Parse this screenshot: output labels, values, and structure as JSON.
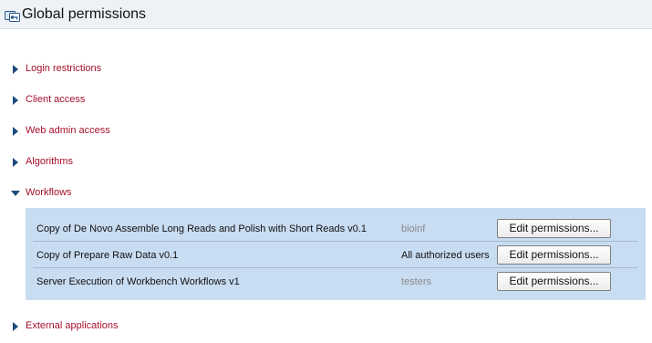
{
  "header": {
    "title": "Global permissions",
    "icon": "permissions-icon"
  },
  "colors": {
    "section_label": "#a4102a",
    "triangle": "#1f4a7c",
    "panel_bg": "#c8dcf2",
    "header_bg": "#eef2f6"
  },
  "sections": [
    {
      "label": "Login restrictions",
      "expanded": false
    },
    {
      "label": "Client access",
      "expanded": false
    },
    {
      "label": "Web admin access",
      "expanded": false
    },
    {
      "label": "Algorithms",
      "expanded": false
    },
    {
      "label": "Workflows",
      "expanded": true
    },
    {
      "label": "External applications",
      "expanded": false
    }
  ],
  "workflows": [
    {
      "name": "Copy of De Novo Assemble Long Reads and Polish with Short Reads v0.1",
      "group": "bioinf",
      "group_muted": true,
      "button": "Edit permissions..."
    },
    {
      "name": "Copy of Prepare Raw Data v0.1",
      "group": "All authorized users",
      "group_muted": false,
      "button": "Edit permissions..."
    },
    {
      "name": "Server Execution of Workbench Workflows v1",
      "group": "testers",
      "group_muted": true,
      "button": "Edit permissions..."
    }
  ]
}
